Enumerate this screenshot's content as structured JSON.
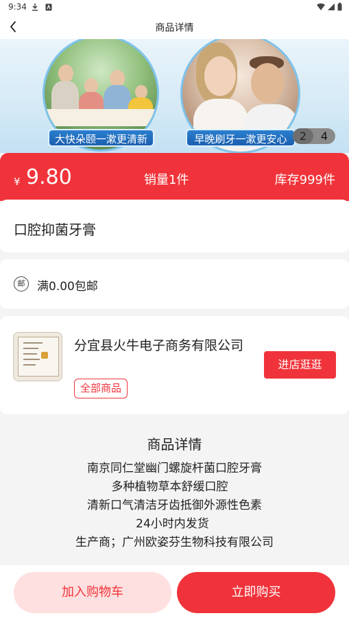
{
  "status_bar": {
    "time": "9:34",
    "left_icons": [
      "download-icon",
      "app-notification-icon"
    ],
    "right_icons": [
      "wifi-icon",
      "signal-icon",
      "battery-icon"
    ]
  },
  "header": {
    "title": "商品详情",
    "back_icon": "chevron-left-icon"
  },
  "banner": {
    "captions": [
      "大快朵颐一漱更清新",
      "早晚刷牙一漱更安心"
    ],
    "indicator": {
      "current": "2",
      "total": "4"
    }
  },
  "price_bar": {
    "currency": "¥",
    "price": "9.80",
    "sales": "销量1件",
    "stock": "库存999件"
  },
  "product": {
    "name": "口腔抑菌牙膏"
  },
  "shipping": {
    "icon_label": "邮",
    "text": "满0.00包邮"
  },
  "shop": {
    "name": "分宜县火牛电子商务有限公司",
    "all_goods_label": "全部商品",
    "visit_label": "进店逛逛"
  },
  "detail": {
    "title": "商品详情",
    "lines": [
      "南京同仁堂幽门螺旋杆菌口腔牙膏",
      "多种植物草本舒缓口腔",
      "清新口气清洁牙齿抵御外源性色素",
      "24小时内发货",
      "生产商；广州欧姿芬生物科技有限公司"
    ]
  },
  "actions": {
    "add_to_cart": "加入购物车",
    "buy_now": "立即购买"
  },
  "colors": {
    "accent": "#f0333a",
    "accent_light": "#fde0df",
    "background": "#f4f4f4"
  }
}
